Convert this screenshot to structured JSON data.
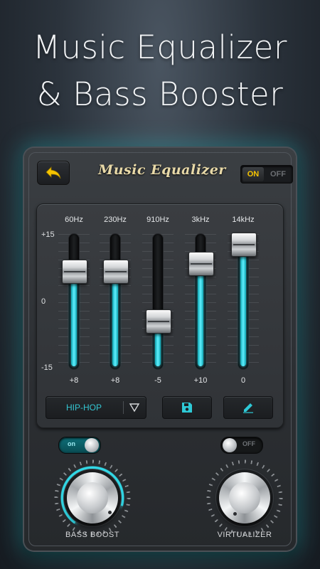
{
  "headline": {
    "line1": "Music Equalizer",
    "line2": "& Bass Booster"
  },
  "topbar": {
    "title": "Music Equalizer",
    "back_icon": "back-arrow-icon",
    "power_toggle": {
      "on_label": "ON",
      "off_label": "OFF",
      "state": "on"
    }
  },
  "equalizer": {
    "scale": {
      "top": "+15",
      "mid": "0",
      "bottom": "-15"
    },
    "range": [
      -15,
      15
    ],
    "bands": [
      {
        "freq": "60Hz",
        "gain_label": "+8",
        "gain": 8
      },
      {
        "freq": "230Hz",
        "gain_label": "+8",
        "gain": 8
      },
      {
        "freq": "910Hz",
        "gain_label": "-5",
        "gain": -5
      },
      {
        "freq": "3kHz",
        "gain_label": "+10",
        "gain": 10
      },
      {
        "freq": "14kHz",
        "gain_label": "0",
        "gain": 15
      }
    ],
    "accent_color": "#3fe3f0"
  },
  "controls": {
    "preset": "HIP-HOP",
    "preset_icon": "triangle-down-icon",
    "save_icon": "floppy-disk-icon",
    "edit_icon": "pencil-icon"
  },
  "bass_boost": {
    "toggle_label": "on",
    "caption": "BASS BOOST",
    "level": 0.7
  },
  "virtualizer": {
    "toggle_label": "OFF",
    "caption": "VIRTUALIZER",
    "level": 0.0
  }
}
